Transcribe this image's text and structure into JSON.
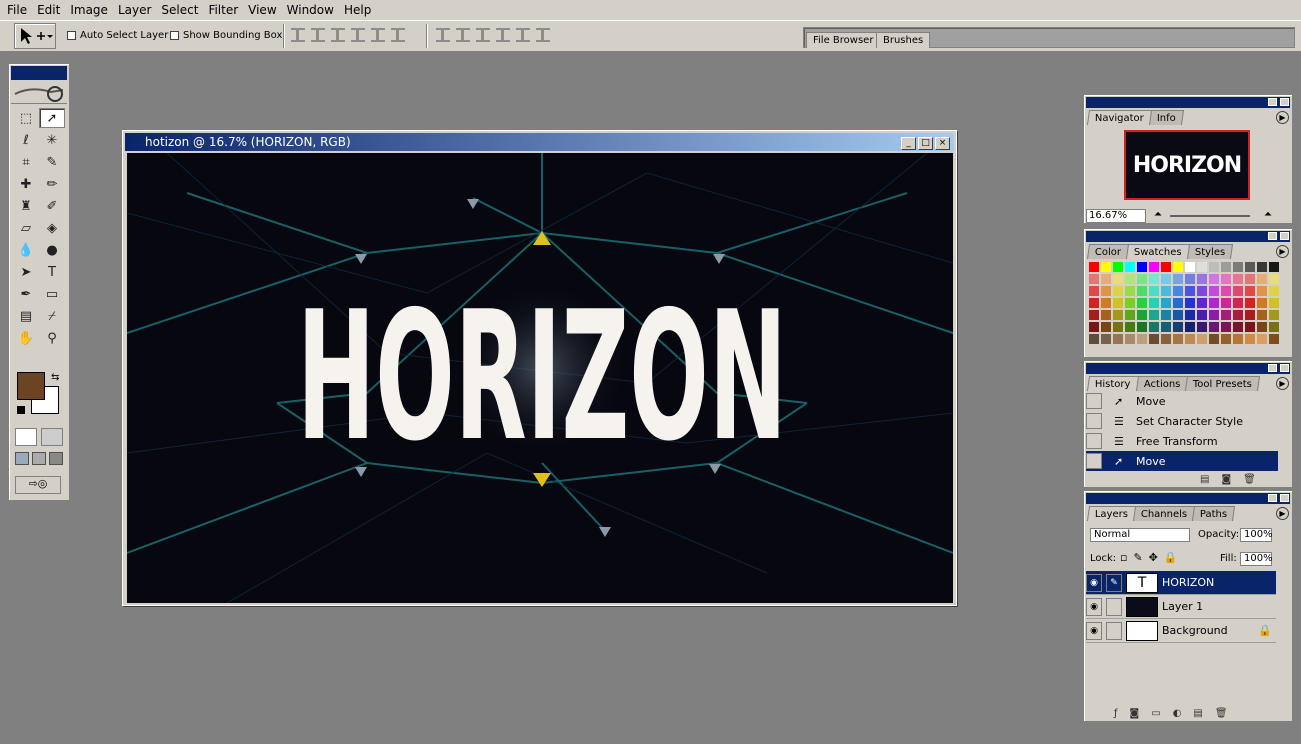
{
  "menu": [
    "File",
    "Edit",
    "Image",
    "Layer",
    "Select",
    "Filter",
    "View",
    "Window",
    "Help"
  ],
  "options": {
    "auto_select_layer": "Auto Select Layer",
    "show_bounding_box": "Show Bounding Box"
  },
  "palette_well": {
    "tabs": [
      "File Browser",
      "Brushes"
    ]
  },
  "document": {
    "title": "hotizon @ 16.7% (HORIZON, RGB)",
    "artwork_text": "HORIZON",
    "buttons": [
      "_",
      "□",
      "×"
    ]
  },
  "navigator": {
    "tabs": [
      "Navigator",
      "Info"
    ],
    "zoom": "16.67%",
    "thumb_text": "HORIZON"
  },
  "color_panel": {
    "tabs": [
      "Color",
      "Swatches",
      "Styles"
    ]
  },
  "history": {
    "tabs": [
      "History",
      "Actions",
      "Tool Presets"
    ],
    "items": [
      "Move",
      "Set Character Style",
      "Free Transform",
      "Move"
    ]
  },
  "layers": {
    "tabs": [
      "Layers",
      "Channels",
      "Paths"
    ],
    "blend_mode": "Normal",
    "opacity_label": "Opacity:",
    "opacity": "100%",
    "lock_label": "Lock:",
    "fill_label": "Fill:",
    "fill": "100%",
    "items": [
      "HORIZON",
      "Layer 1",
      "Background"
    ]
  },
  "colors": {
    "foreground": "#6b4423",
    "background": "#ffffff",
    "accent": "#0a246a",
    "canvas": "#05060f"
  }
}
